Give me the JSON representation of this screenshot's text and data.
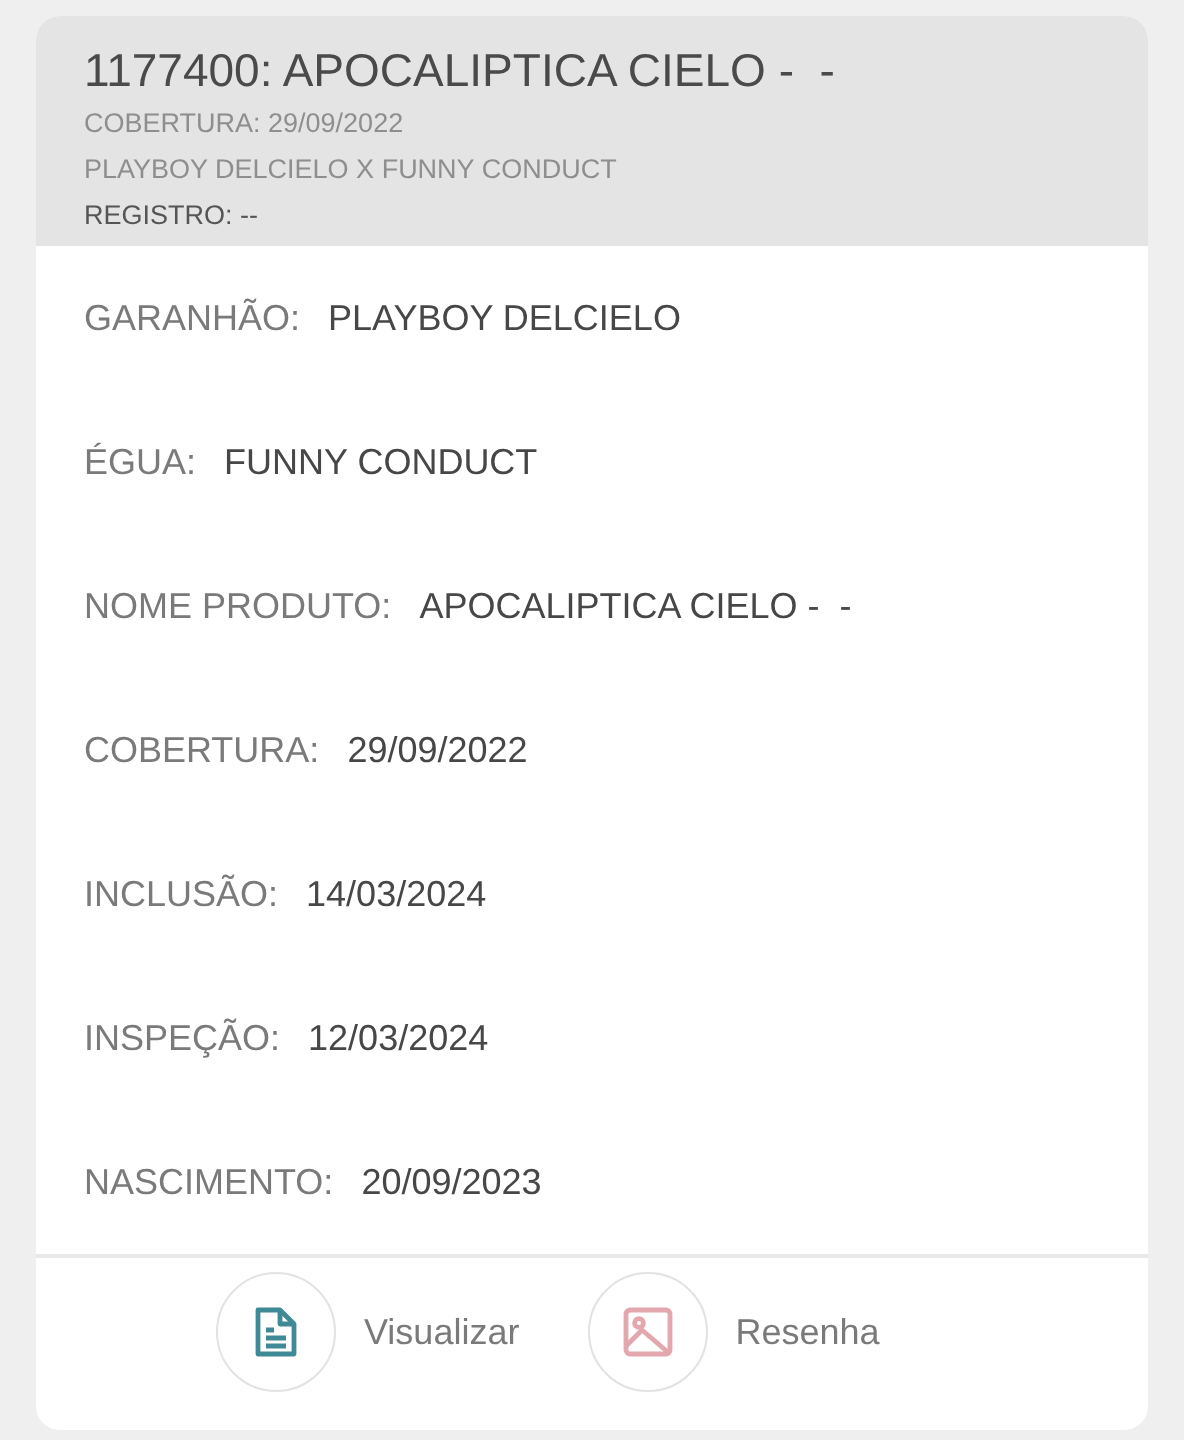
{
  "header": {
    "title": "1177400: APOCALIPTICA CIELO -  -",
    "subtitles": [
      "COBERTURA: 29/09/2022",
      "PLAYBOY DELCIELO X FUNNY CONDUCT"
    ],
    "registry": "REGISTRO: --"
  },
  "fields": [
    {
      "label": "GARANHÃO:",
      "value": "PLAYBOY DELCIELO"
    },
    {
      "label": "ÉGUA:",
      "value": "FUNNY CONDUCT"
    },
    {
      "label": "NOME PRODUTO:",
      "value": "APOCALIPTICA CIELO -  -"
    },
    {
      "label": "COBERTURA:",
      "value": "29/09/2022"
    },
    {
      "label": "INCLUSÃO:",
      "value": "14/03/2024"
    },
    {
      "label": "INSPEÇÃO:",
      "value": "12/03/2024"
    },
    {
      "label": "NASCIMENTO:",
      "value": "20/09/2023"
    }
  ],
  "actions": [
    {
      "kind": "document",
      "label": "Visualizar"
    },
    {
      "kind": "image",
      "label": "Resenha"
    }
  ]
}
